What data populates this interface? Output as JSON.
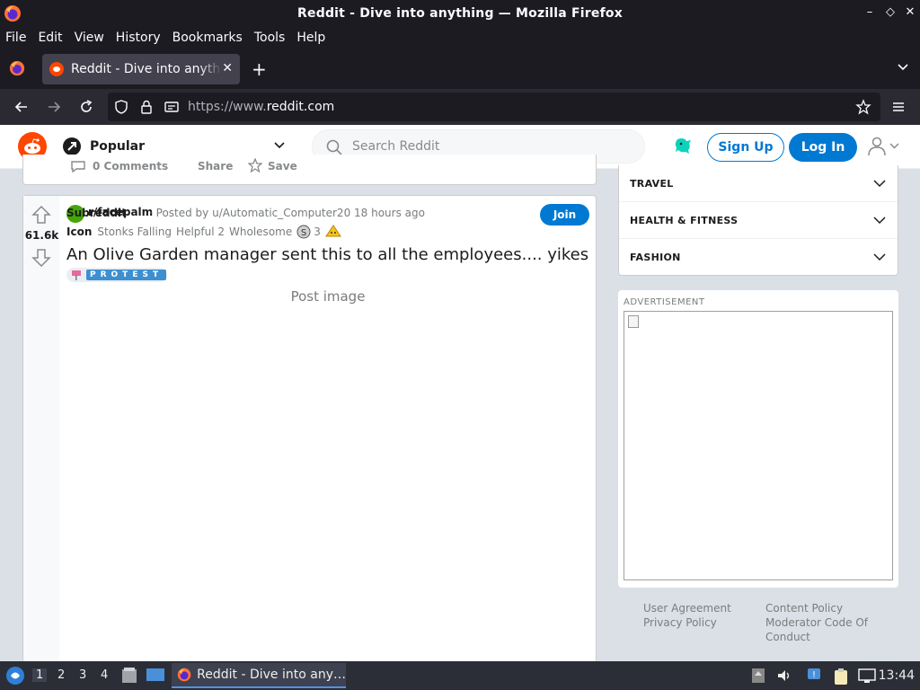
{
  "window": {
    "title": "Reddit - Dive into anything — Mozilla Firefox",
    "minimize": "–",
    "maximize": "◇",
    "close": "✕"
  },
  "menu": [
    "File",
    "Edit",
    "View",
    "History",
    "Bookmarks",
    "Tools",
    "Help"
  ],
  "tab": {
    "label": "Reddit - Dive into anything",
    "close": "✕",
    "new_tab": "+"
  },
  "urlbar": {
    "prefix": "https://www.",
    "domain": "reddit.com"
  },
  "reddit": {
    "feed": "Popular",
    "search_placeholder": "Search Reddit",
    "sign_up": "Sign Up",
    "log_in": "Log In"
  },
  "prev_post": {
    "comments": "0 Comments",
    "share": "Share",
    "save": "Save"
  },
  "post": {
    "votes": "61.6k",
    "subreddit_avatar_alt": "Subreddit",
    "subreddit": "r/facepalm",
    "posted_by": "· Posted by u/Automatic_Computer20 18 hours ago",
    "join": "Join",
    "icon_alt": "Icon",
    "awards": [
      "Stonks Falling",
      "Helpful 2",
      "Wholesome"
    ],
    "award_count": "3",
    "title": "An Olive Garden manager sent this to all the employees.... yikes",
    "flair": "PROTEST",
    "image_alt": "Post image"
  },
  "sidebar": {
    "topics": [
      "TRAVEL",
      "HEALTH & FITNESS",
      "FASHION"
    ],
    "ad_label": "ADVERTISEMENT",
    "footer": {
      "user_agreement": "User Agreement",
      "privacy_policy": "Privacy Policy",
      "content_policy": "Content Policy",
      "moderator_code_1": "Moderator Code Of",
      "moderator_code_2": "Conduct"
    }
  },
  "taskbar": {
    "workspaces": [
      "1",
      "2",
      "3",
      "4"
    ],
    "task_label": "Reddit - Dive into any…",
    "clock": "13:44"
  },
  "colors": {
    "reddit_orange": "#ff4500",
    "reddit_blue": "#0079d3",
    "firefox_dark": "#1c1b22"
  }
}
